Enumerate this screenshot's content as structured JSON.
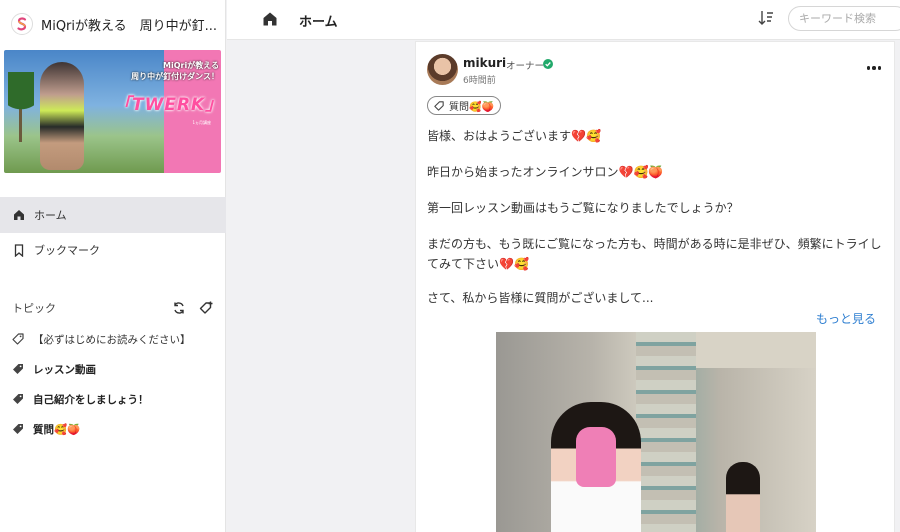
{
  "brand": {
    "name": "MiQriが教える　周り中が釘..."
  },
  "banner": {
    "line1": "MiQriが教える",
    "line2": "周り中が釘付けダンス！",
    "title": "「TWERK」",
    "small": "1ヵ月講座"
  },
  "nav": [
    {
      "label": "ホーム",
      "icon": "home-icon",
      "active": true
    },
    {
      "label": "ブックマーク",
      "icon": "bookmark-icon",
      "active": false
    }
  ],
  "topics": {
    "heading": "トピック",
    "items": [
      {
        "label": "【必ずはじめにお読みください】",
        "bold": false
      },
      {
        "label": "レッスン動画",
        "bold": true
      },
      {
        "label": "自己紹介をしましょう！",
        "bold": true
      },
      {
        "label": "質問🥰🍑",
        "bold": true
      }
    ]
  },
  "header": {
    "title": "ホーム",
    "search_placeholder": "キーワード検索"
  },
  "post": {
    "author": "mikuri",
    "role": "オーナー",
    "time": "6時間前",
    "tag": "質問🥰🍑",
    "paragraphs": [
      "皆様、おはようございます💔🥰",
      "昨日から始まったオンラインサロン💔🥰🍑",
      "第一回レッスン動画はもうご覧になりましたでしょうか？",
      "まだの方も、もう既にご覧になった方も、時間がある時に是非ぜひ、頻繁にトライしてみて下さい💔🥰",
      "さて、私から皆様に質問がございまして..."
    ],
    "more_label": "もっと見る"
  },
  "colors": {
    "accent_link": "#2f7fd1",
    "verified": "#22a96b",
    "active_nav_bg": "#e6e6ea"
  }
}
